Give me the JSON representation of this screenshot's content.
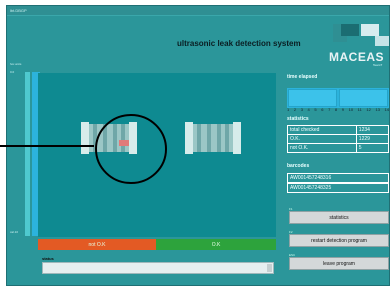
{
  "window": {
    "title": "lbt.DBGP"
  },
  "header": {
    "title": "ultrasonic leak detection system"
  },
  "logo": {
    "text": "MACEAS",
    "subtext": "TeamT"
  },
  "level_bar": {
    "top_label": "hor.units",
    "mid_label": "0.0",
    "bottom_label": "cal.10"
  },
  "results": {
    "fail_label": "not O.K",
    "pass_label": "O.K",
    "fail_color": "#e35a24",
    "pass_color": "#2da33c"
  },
  "status": {
    "label": "status",
    "value": ""
  },
  "time": {
    "label": "time elapsed",
    "ticks": [
      "1",
      "2",
      "3",
      "4",
      "5",
      "6",
      "7",
      "8",
      "9",
      "10",
      "11",
      "12",
      "13",
      "14"
    ]
  },
  "statistics": {
    "label": "statistics",
    "rows": [
      {
        "key": "total checked",
        "value": "1234"
      },
      {
        "key": "O.K.",
        "value": "1229"
      },
      {
        "key": "not O.K.",
        "value": "5"
      }
    ]
  },
  "barcodes": {
    "label": "barcodes",
    "items": [
      "AW001457248316",
      "AW001457248325"
    ]
  },
  "buttons": {
    "statistics": {
      "key": "F1",
      "label": "statistics"
    },
    "restart": {
      "key": "F2",
      "label": "restart detection program"
    },
    "leave": {
      "key": "ESC",
      "label": "leave program"
    }
  },
  "colors": {
    "panel": "#2b969a",
    "view": "#0e8a91",
    "bar": "#2cb3dc"
  }
}
